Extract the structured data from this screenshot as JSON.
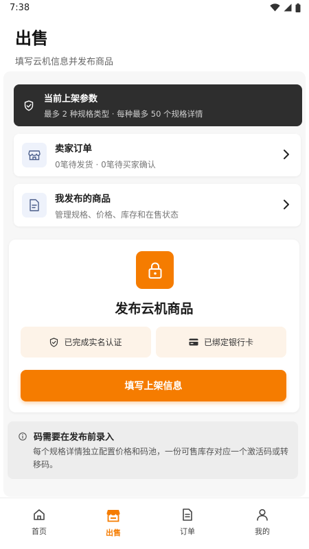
{
  "status_bar": {
    "time": "7:38"
  },
  "header": {
    "title": "出售",
    "subtitle": "填写云机信息并发布商品"
  },
  "notice": {
    "title": "当前上架参数",
    "description": "最多 2 种规格类型 · 每种最多 50 个规格详情"
  },
  "links": [
    {
      "title": "卖家订单",
      "description": "0笔待发货 · 0笔待买家确认",
      "icon": "storefront-icon"
    },
    {
      "title": "我发布的商品",
      "description": "管理规格、价格、库存和在售状态",
      "icon": "document-icon"
    }
  ],
  "publish": {
    "title": "发布云机商品",
    "badges": [
      {
        "label": "已完成实名认证",
        "icon": "shield-check-icon"
      },
      {
        "label": "已绑定银行卡",
        "icon": "bank-card-icon"
      }
    ],
    "cta_label": "填写上架信息"
  },
  "info": {
    "title": "码需要在发布前录入",
    "text": "每个规格详情独立配置价格和码池，一份可售库存对应一个激活码或转移码。"
  },
  "nav": {
    "items": [
      {
        "label": "首页",
        "icon": "home-icon"
      },
      {
        "label": "出售",
        "icon": "store-icon"
      },
      {
        "label": "订单",
        "icon": "orders-icon"
      },
      {
        "label": "我的",
        "icon": "profile-icon"
      }
    ],
    "active_index": 1
  },
  "colors": {
    "accent": "#f57c00",
    "dark_notice": "#2e2e2e",
    "chip_bg": "#fdf3e8"
  }
}
